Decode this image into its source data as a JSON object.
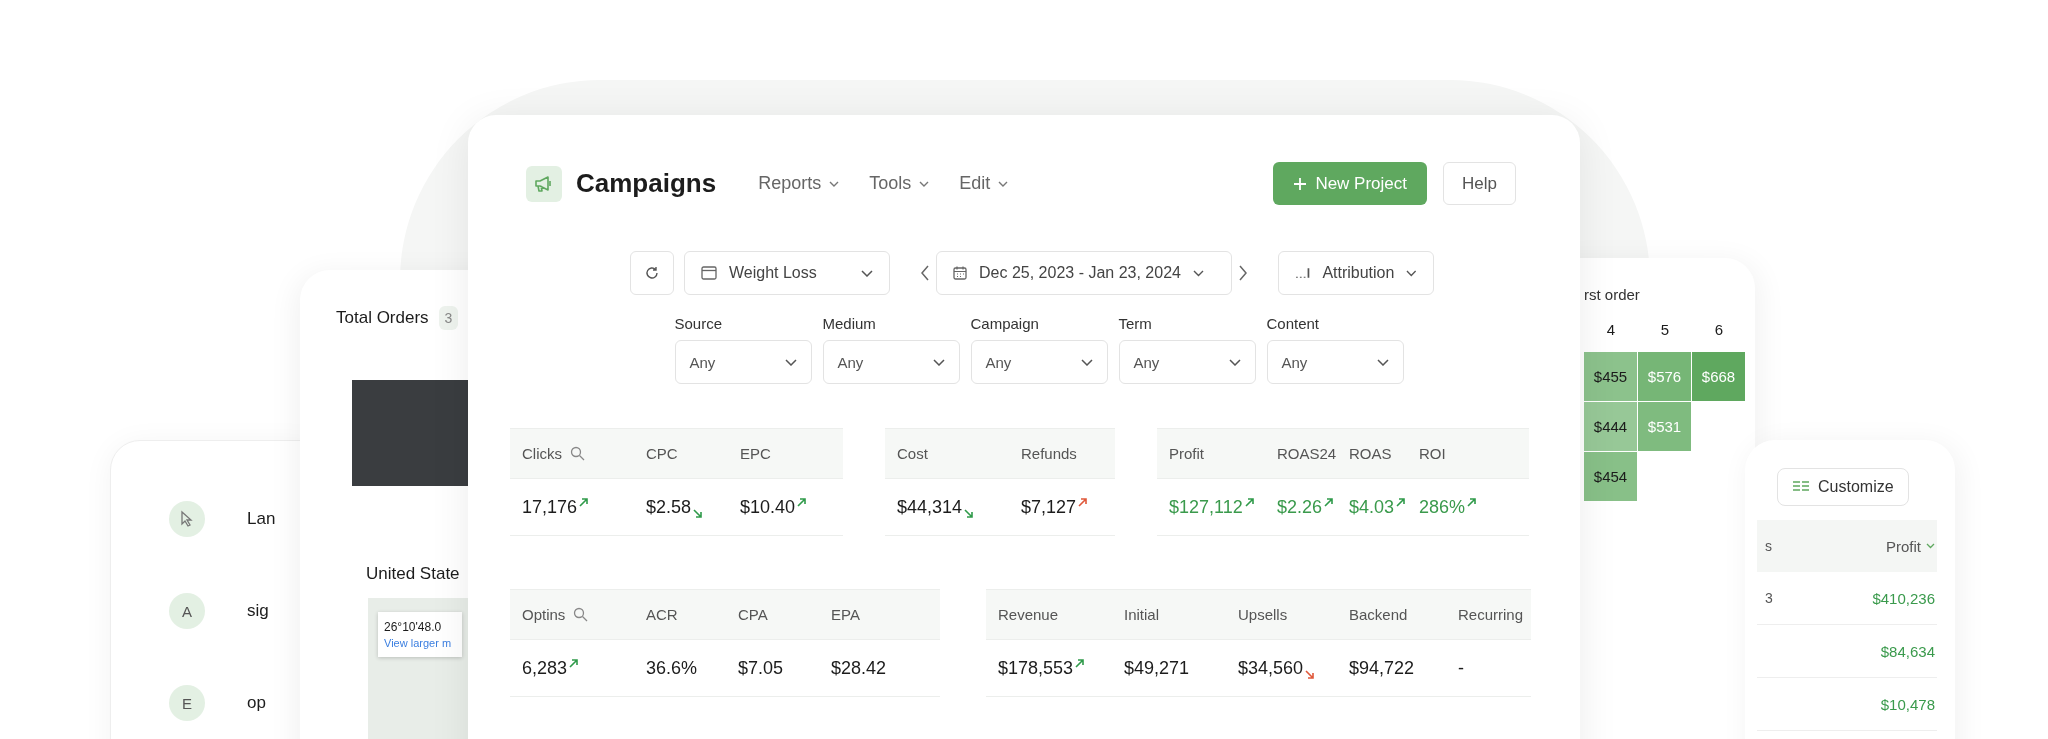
{
  "flow_card": {
    "steps": [
      {
        "kind": "pointer",
        "label": "Lan"
      },
      {
        "kind": "letter",
        "letter": "A",
        "label": "sig"
      },
      {
        "kind": "letter",
        "letter": "E",
        "label": "op"
      }
    ]
  },
  "orders_card": {
    "title": "Total Orders",
    "badge": "3",
    "location": "United State",
    "map_popup": {
      "coords": "26°10'48.0",
      "link": "View larger m"
    }
  },
  "cohort_card": {
    "title": "rst order",
    "columns": [
      "4",
      "5",
      "6"
    ],
    "rows": [
      [
        {
          "value": "$455",
          "color": "#8cc28c",
          "light_text": false
        },
        {
          "value": "$576",
          "color": "#76b676",
          "light_text": true
        },
        {
          "value": "$668",
          "color": "#5fa85f",
          "light_text": true
        }
      ],
      [
        {
          "value": "$444",
          "color": "#97c897",
          "light_text": false
        },
        {
          "value": "$531",
          "color": "#7fbb7f",
          "light_text": true
        }
      ],
      [
        {
          "value": "$454",
          "color": "#88c088",
          "light_text": false
        }
      ]
    ]
  },
  "table_card": {
    "customize_label": "Customize",
    "columns": [
      "s",
      "Profit"
    ],
    "rows": [
      {
        "column_1": "3",
        "profit": "$410,236"
      },
      {
        "profit": "$84,634"
      },
      {
        "profit": "$10,478"
      }
    ]
  },
  "header": {
    "title": "Campaigns",
    "menus": [
      "Reports",
      "Tools",
      "Edit"
    ],
    "buttons": [
      {
        "label": "New Project",
        "kind": "primary"
      },
      {
        "label": "Help",
        "kind": "secondary"
      }
    ]
  },
  "toolbar": {
    "project": "Weight Loss",
    "date_range": "Dec 25, 2023 - Jan 23, 2024",
    "attribution": "Attribution"
  },
  "filters": [
    {
      "label": "Source",
      "value": "Any"
    },
    {
      "label": "Medium",
      "value": "Any"
    },
    {
      "label": "Campaign",
      "value": "Any"
    },
    {
      "label": "Term",
      "value": "Any"
    },
    {
      "label": "Content",
      "value": "Any"
    }
  ],
  "metric_rows": [
    [
      {
        "highlight": false,
        "columns": [
          {
            "label": "Clicks",
            "searchable": true,
            "value": "17,176",
            "rising": true,
            "good": true
          },
          {
            "label": "CPC",
            "value": "$2.58",
            "rising": false,
            "good": true
          },
          {
            "label": "EPC",
            "value": "$10.40",
            "rising": true,
            "good": true
          }
        ]
      },
      {
        "highlight": false,
        "columns": [
          {
            "label": "Cost",
            "value": "$44,314",
            "rising": false,
            "good": true
          },
          {
            "label": "Refunds",
            "value": "$7,127",
            "rising": true,
            "good": false
          }
        ]
      },
      {
        "highlight": true,
        "columns": [
          {
            "label": "Profit",
            "value": "$127,112",
            "rising": true,
            "good": true
          },
          {
            "label": "ROAS24",
            "value": "$2.26",
            "rising": true,
            "good": true
          },
          {
            "label": "ROAS",
            "value": "$4.03",
            "rising": true,
            "good": true
          },
          {
            "label": "ROI",
            "value": "286%",
            "rising": true,
            "good": true
          }
        ]
      }
    ],
    [
      {
        "highlight": false,
        "columns": [
          {
            "label": "Optins",
            "searchable": true,
            "value": "6,283",
            "rising": true,
            "good": true
          },
          {
            "label": "ACR",
            "value": "36.6%"
          },
          {
            "label": "CPA",
            "value": "$7.05"
          },
          {
            "label": "EPA",
            "value": "$28.42"
          }
        ]
      },
      {
        "highlight": false,
        "columns": [
          {
            "label": "Revenue",
            "value": "$178,553",
            "rising": true,
            "good": true
          },
          {
            "label": "Initial",
            "value": "$49,271"
          },
          {
            "label": "Upsells",
            "value": "$34,560",
            "rising": false,
            "good": false
          },
          {
            "label": "Backend",
            "value": "$94,722"
          },
          {
            "label": "Recurring",
            "value": "-"
          }
        ]
      }
    ]
  ]
}
